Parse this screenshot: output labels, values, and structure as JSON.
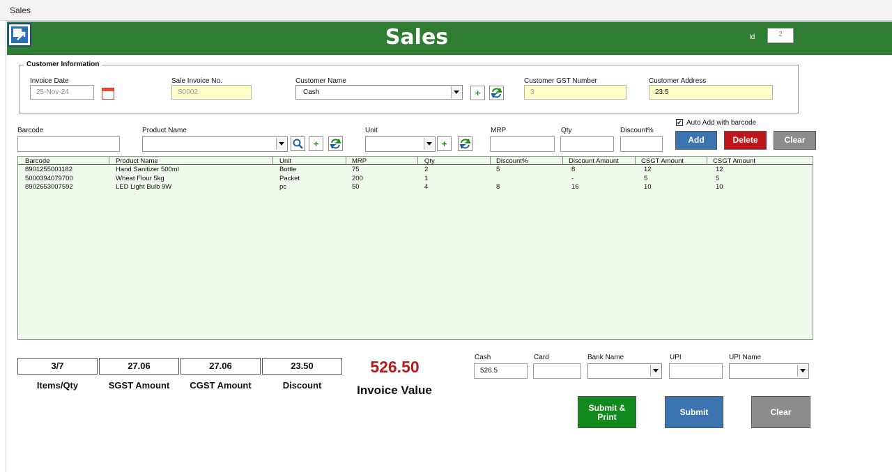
{
  "window": {
    "title": "Sales"
  },
  "header": {
    "title": "Sales",
    "id_label": "Id",
    "id_value": "2"
  },
  "customer": {
    "group_label": "Customer Information",
    "invoice_date_label": "Invoice Date",
    "invoice_date": "25-Nov-24",
    "sale_invoice_label": "Sale Invoice No.",
    "sale_invoice": "S0002",
    "customer_name_label": "Customer Name",
    "customer_name": "Cash",
    "gst_label": "Customer GST Number",
    "gst_value": "3",
    "address_label": "Customer Address",
    "address_value": "23.5"
  },
  "entry": {
    "barcode_label": "Barcode",
    "product_label": "Product Name",
    "unit_label": "Unit",
    "mrp_label": "MRP",
    "qty_label": "Qty",
    "discount_label": "Discount%",
    "auto_add_label": "Auto Add with barcode",
    "auto_add_checked": "✔",
    "add_button": "Add",
    "delete_button": "Delete",
    "clear_button": "Clear"
  },
  "grid": {
    "columns": [
      "Barcode",
      "Product Name",
      "Unit",
      "MRP",
      "Qty",
      "Discount%",
      "Discount Amount",
      "CSGT Amount",
      "CSGT Amount"
    ],
    "rows": [
      [
        "8901255001182",
        "Hand Sanitizer 500ml",
        "Bottle",
        "75",
        "2",
        "5",
        "8",
        "12",
        "12"
      ],
      [
        "5000394079700",
        "Wheat Flour 5kg",
        "Packet",
        "200",
        "1",
        "",
        "-",
        "5",
        "5"
      ],
      [
        "8902653007592",
        "LED Light Bulb 9W",
        "pc",
        "50",
        "4",
        "8",
        "16",
        "10",
        "10"
      ]
    ]
  },
  "summary": {
    "items_qty": "3/7",
    "items_qty_label": "Items/Qty",
    "sgst": "27.06",
    "sgst_label": "SGST Amount",
    "cgst": "27.06",
    "cgst_label": "CGST Amount",
    "discount": "23.50",
    "discount_label": "Discount",
    "invoice_value": "526.50",
    "invoice_value_label": "Invoice Value"
  },
  "payment": {
    "cash_label": "Cash",
    "cash_value": "526.5",
    "card_label": "Card",
    "bank_label": "Bank Name",
    "upi_label": "UPI",
    "upi_name_label": "UPI Name"
  },
  "actions": {
    "submit_print_line1": "Submit &",
    "submit_print_line2": "Print",
    "submit": "Submit",
    "clear": "Clear"
  },
  "colors": {
    "header_green": "#2e7d32",
    "grid_bg": "#eefbea",
    "invoice_red": "#b71c1c",
    "field_yellow": "#ffffcc"
  }
}
